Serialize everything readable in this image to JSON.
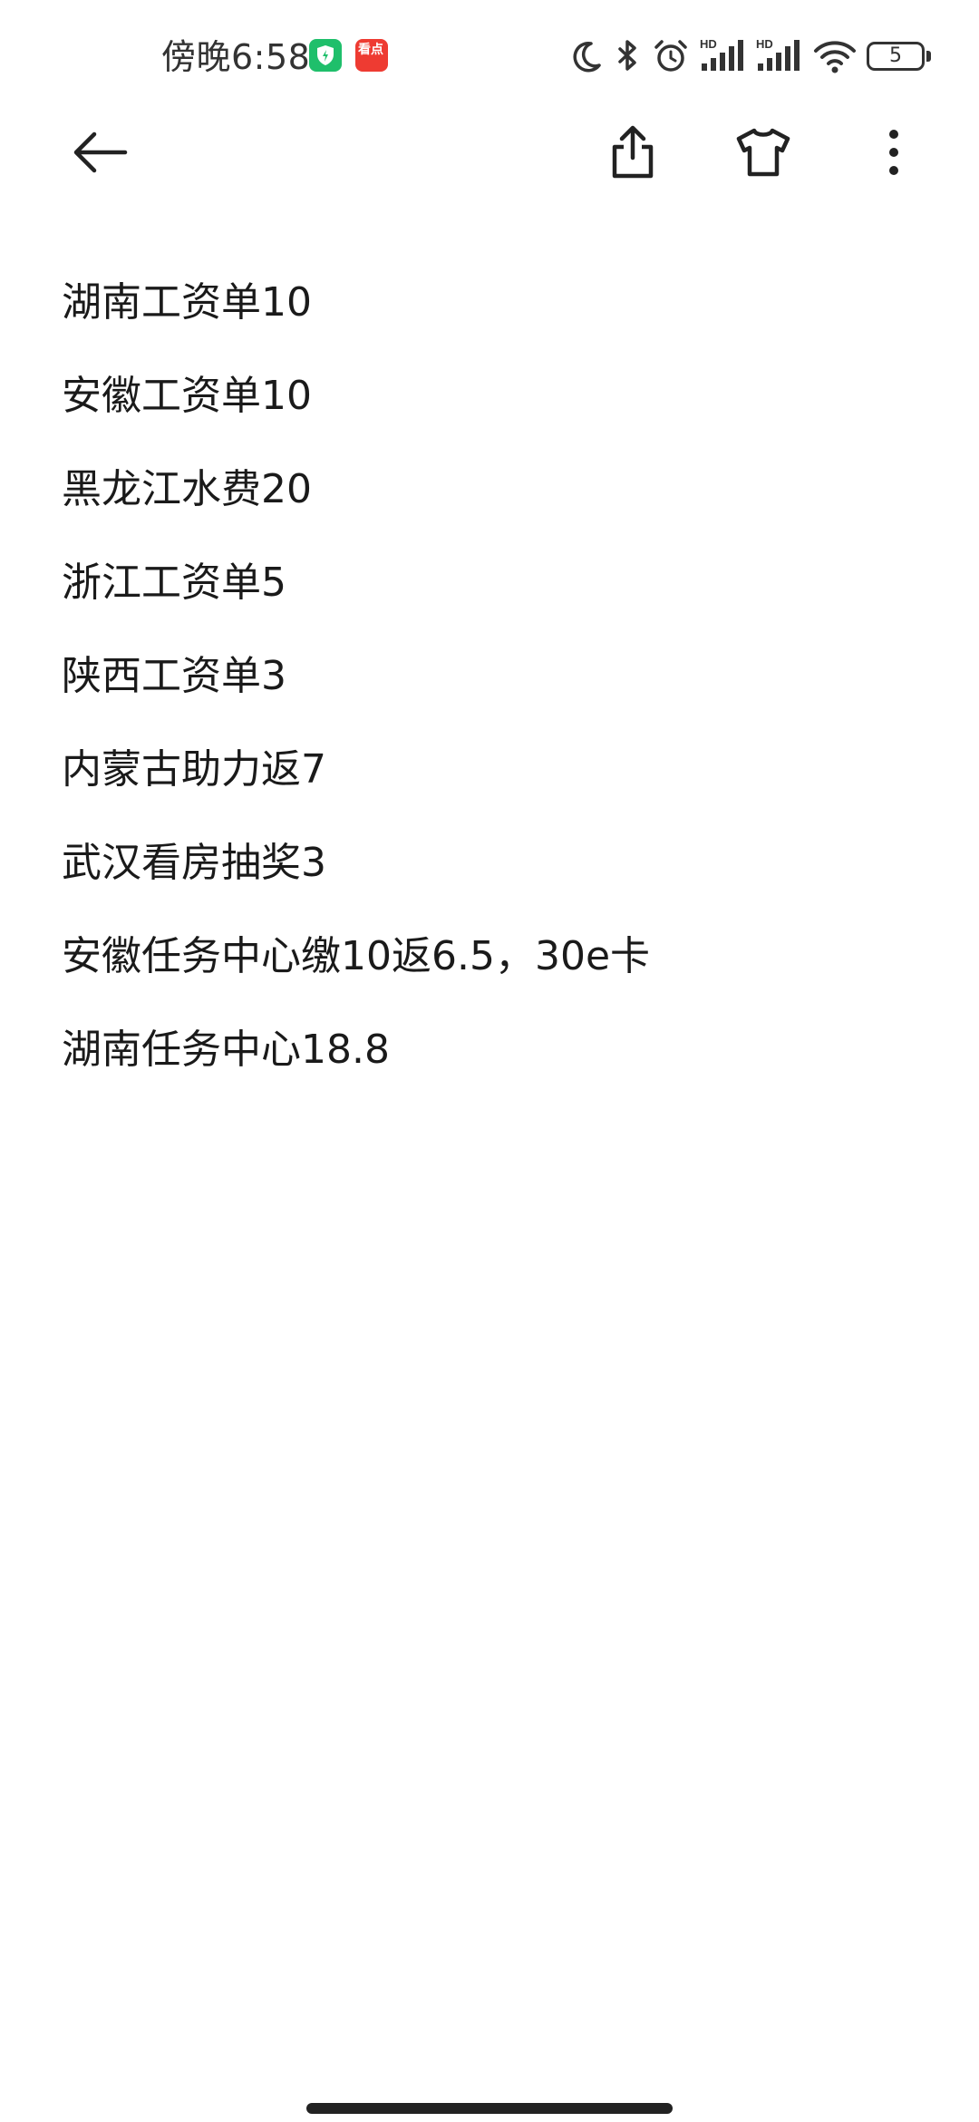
{
  "status_bar": {
    "time": "傍晚6:58",
    "news_app_label": "看点",
    "signal_label_1": "HD",
    "signal_label_2": "HD",
    "battery_level": "5",
    "icons": [
      "shield-icon",
      "news-app-icon",
      "moon-icon",
      "bluetooth-icon",
      "alarm-icon",
      "signal-icon",
      "signal-icon",
      "wifi-icon",
      "battery-icon"
    ]
  },
  "toolbar": {
    "icons": [
      "back-arrow-icon",
      "share-icon",
      "tshirt-icon",
      "more-vertical-icon"
    ]
  },
  "note": {
    "lines": [
      "湖南工资单10",
      "安徽工资单10",
      "黑龙江水费20",
      "浙江工资单5",
      "陕西工资单3",
      "内蒙古助力返7",
      "武汉看房抽奖3",
      "安徽任务中心缴10返6.5，30e卡",
      "湖南任务中心18.8"
    ]
  },
  "colors": {
    "text": "#1a1a1a",
    "background": "#ffffff",
    "shield_icon": "#1fbf6b",
    "news_icon": "#ee3b32"
  }
}
